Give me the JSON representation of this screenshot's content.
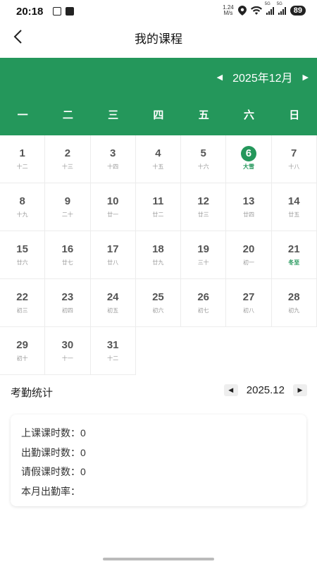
{
  "status_bar": {
    "time": "20:18",
    "net_speed_value": "1.24",
    "net_speed_unit": "M/s",
    "sig1": "5G",
    "sig2": "5G",
    "battery": "89"
  },
  "header": {
    "title": "我的课程"
  },
  "calendar": {
    "month_label": "2025年12月",
    "weekdays": [
      "一",
      "二",
      "三",
      "四",
      "五",
      "六",
      "日"
    ],
    "today": 6,
    "accent_color": "#24975b",
    "rows": [
      [
        {
          "d": "1",
          "l": "十二"
        },
        {
          "d": "2",
          "l": "十三"
        },
        {
          "d": "3",
          "l": "十四"
        },
        {
          "d": "4",
          "l": "十五"
        },
        {
          "d": "5",
          "l": "十六"
        },
        {
          "d": "6",
          "l": "大雪"
        },
        {
          "d": "7",
          "l": "十八"
        }
      ],
      [
        {
          "d": "8",
          "l": "十九"
        },
        {
          "d": "9",
          "l": "二十"
        },
        {
          "d": "10",
          "l": "廿一"
        },
        {
          "d": "11",
          "l": "廿二"
        },
        {
          "d": "12",
          "l": "廿三"
        },
        {
          "d": "13",
          "l": "廿四"
        },
        {
          "d": "14",
          "l": "廿五"
        }
      ],
      [
        {
          "d": "15",
          "l": "廿六"
        },
        {
          "d": "16",
          "l": "廿七"
        },
        {
          "d": "17",
          "l": "廿八"
        },
        {
          "d": "18",
          "l": "廿九"
        },
        {
          "d": "19",
          "l": "三十"
        },
        {
          "d": "20",
          "l": "初一"
        },
        {
          "d": "21",
          "l": "冬至"
        }
      ],
      [
        {
          "d": "22",
          "l": "初三"
        },
        {
          "d": "23",
          "l": "初四"
        },
        {
          "d": "24",
          "l": "初五"
        },
        {
          "d": "25",
          "l": "初六"
        },
        {
          "d": "26",
          "l": "初七"
        },
        {
          "d": "27",
          "l": "初八"
        },
        {
          "d": "28",
          "l": "初九"
        }
      ],
      [
        {
          "d": "29",
          "l": "初十"
        },
        {
          "d": "30",
          "l": "十一"
        },
        {
          "d": "31",
          "l": "十二"
        }
      ]
    ],
    "solar_terms": [
      "大雪",
      "冬至"
    ]
  },
  "attendance": {
    "title": "考勤统计",
    "month": "2025.12",
    "class_hours": "上课课时数：0",
    "attend_hours": "出勤课时数：0",
    "leave_hours": "请假课时数：0",
    "rate": "本月出勤率："
  }
}
